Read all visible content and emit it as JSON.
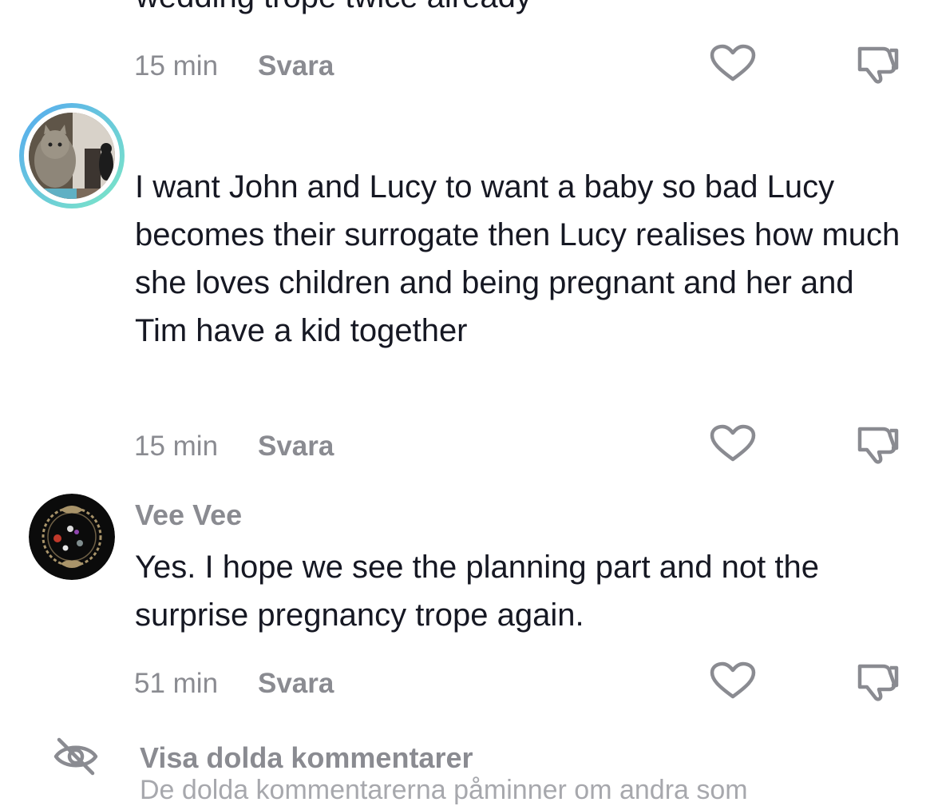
{
  "top_comment": {
    "text_tail": "wedding trope twice already",
    "time": "15 min",
    "reply_label": "Svara"
  },
  "comments": [
    {
      "username": "",
      "text": "I want John and Lucy to want a baby so bad Lucy becomes their surrogate then Lucy realises how much she loves children and being pregnant and her and Tim have a kid together",
      "time": "15 min",
      "reply_label": "Svara",
      "avatar_icon": "cat-photo-avatar",
      "avatar_ring_colors": [
        "#55a9f0",
        "#7de8c6"
      ]
    },
    {
      "username": "Vee Vee",
      "text": "Yes. I hope we see the planning part and not the surprise pregnancy trope again.",
      "time": "51 min",
      "reply_label": "Svara",
      "avatar_icon": "ornate-frame-avatar"
    }
  ],
  "hidden_comments": {
    "label": "Visa dolda kommentarer",
    "description": "De dolda kommentarerna påminner om andra som",
    "icon": "eye-off-icon"
  },
  "colors": {
    "text_primary": "#161823",
    "text_secondary": "#8a8b91",
    "icon_gray": "#8a8b91"
  }
}
